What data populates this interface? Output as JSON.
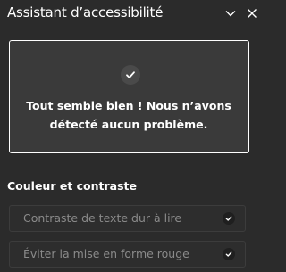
{
  "header": {
    "title": "Assistant d’accessibilité",
    "collapse_icon": "chevron-down-icon",
    "close_icon": "close-icon"
  },
  "status": {
    "icon": "checkmark-icon",
    "message": "Tout semble bien ! Nous n’avons détecté aucun problème."
  },
  "section": {
    "title": "Couleur et contraste",
    "items": [
      {
        "label": "Contraste de texte dur à lire",
        "icon": "checkmark-icon"
      },
      {
        "label": "Éviter la mise en forme rouge",
        "icon": "checkmark-icon"
      }
    ]
  },
  "colors": {
    "background": "#2b2b2b",
    "card": "#3a3a3a",
    "text": "#ffffff",
    "muted_text": "#8a8a8a"
  }
}
